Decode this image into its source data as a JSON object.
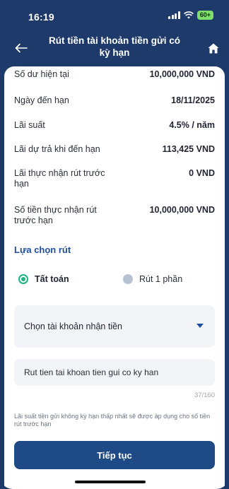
{
  "status_bar": {
    "time": "16:19",
    "battery": "60+"
  },
  "header": {
    "title": "Rút tiền tài khoản tiền gửi có kỳ hạn"
  },
  "details": [
    {
      "label": "Số dư hiện tại",
      "value": "10,000,000 VND"
    },
    {
      "label": "Ngày đến hạn",
      "value": "18/11/2025"
    },
    {
      "label": "Lãi suất",
      "value": "4.5% / năm"
    },
    {
      "label": "Lãi dự trả khi đến hạn",
      "value": "113,425 VND"
    },
    {
      "label": "Lãi thực nhận rút trước hạn",
      "value": "0 VND"
    },
    {
      "label": "Số tiền thực nhận rút trước hạn",
      "value": "10,000,000 VND"
    }
  ],
  "withdraw_options": {
    "title": "Lựa chọn rút",
    "options": [
      {
        "label": "Tất toán",
        "selected": true
      },
      {
        "label": "Rút 1 phần",
        "selected": false
      }
    ]
  },
  "receiving_account": {
    "placeholder": "Chọn tài khoản nhận tiền"
  },
  "description": {
    "value": "Rut tien tai khoan tien gui co ky han",
    "counter": "37/160"
  },
  "note": "Lãi suất tiền gửi không kỳ hạn thấp nhất sẽ được áp dụng cho số tiền rút trước hạn",
  "actions": {
    "continue_label": "Tiếp tục"
  },
  "colors": {
    "header_bg": "#1e3a6b",
    "accent": "#1e4ea0",
    "selected_radio": "#1db583",
    "button_bg": "#1e4a86"
  }
}
